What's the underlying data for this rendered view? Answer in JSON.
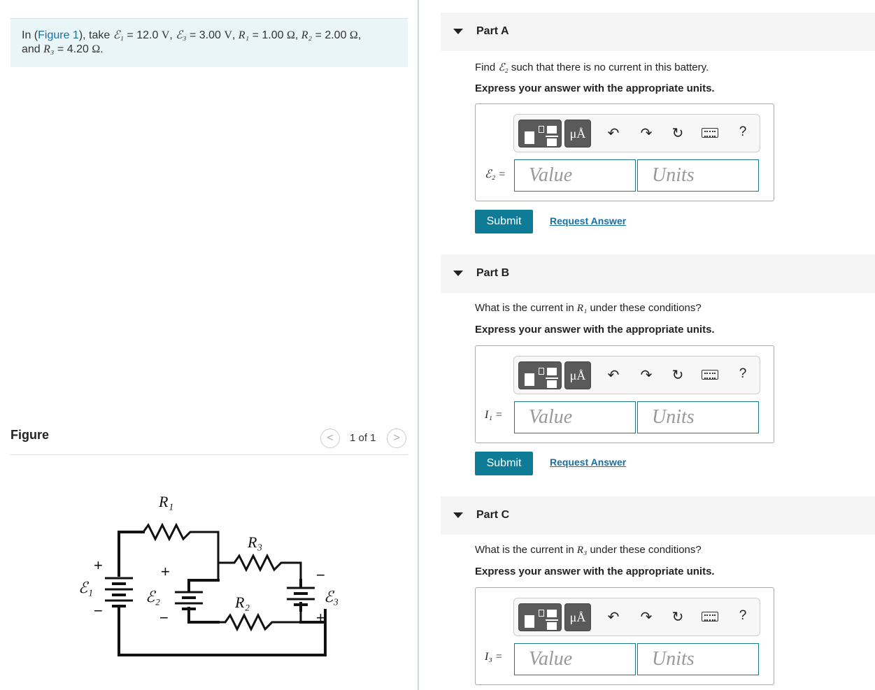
{
  "problem": {
    "intro": "In (",
    "figure_link": "Figure 1",
    "after_link": "), take ",
    "e1_sym": "ℰ₁",
    "e1_val": " = 12.0 ",
    "e1_unit": "V",
    "e3_sym": "ℰ₃",
    "e3_val": " = 3.00 ",
    "e3_unit": "V",
    "r1_sym": "R₁",
    "r1_val": " = 1.00 ",
    "r1_unit": "Ω",
    "r2_sym": "R₂",
    "r2_val": " = 2.00 ",
    "r2_unit": "Ω",
    "and": "and ",
    "r3_sym": "R₃",
    "r3_val": " = 4.20 ",
    "r3_unit": "Ω",
    "period": "."
  },
  "figure": {
    "label": "Figure",
    "page_count": "1 of 1",
    "prev": "<",
    "next": ">",
    "circuit_labels": {
      "r1": "R₁",
      "r2": "R₂",
      "r3": "R₃",
      "e1": "ℰ₁",
      "e2": "ℰ₂",
      "e3": "ℰ₃",
      "plus": "+",
      "minus": "−"
    }
  },
  "toolbar": {
    "unit_btn": "μÅ",
    "undo": "↶",
    "redo": "↷",
    "reset": "↻",
    "help": "?"
  },
  "parts": [
    {
      "title": "Part A",
      "question_pre": "Find ",
      "question_sym": "ℰ₂",
      "question_post": " such that there is no current in this battery.",
      "express": "Express your answer with the appropriate units.",
      "answer_label": "ℰ₂ =",
      "value_placeholder": "Value",
      "units_placeholder": "Units",
      "submit": "Submit",
      "request": "Request Answer"
    },
    {
      "title": "Part B",
      "question_pre": "What is the current in ",
      "question_sym": "R₁",
      "question_post": " under these conditions?",
      "express": "Express your answer with the appropriate units.",
      "answer_label": "I₁ =",
      "value_placeholder": "Value",
      "units_placeholder": "Units",
      "submit": "Submit",
      "request": "Request Answer"
    },
    {
      "title": "Part C",
      "question_pre": "What is the current in ",
      "question_sym": "R₃",
      "question_post": " under these conditions?",
      "express": "Express your answer with the appropriate units.",
      "answer_label": "I₃ =",
      "value_placeholder": "Value",
      "units_placeholder": "Units"
    }
  ]
}
